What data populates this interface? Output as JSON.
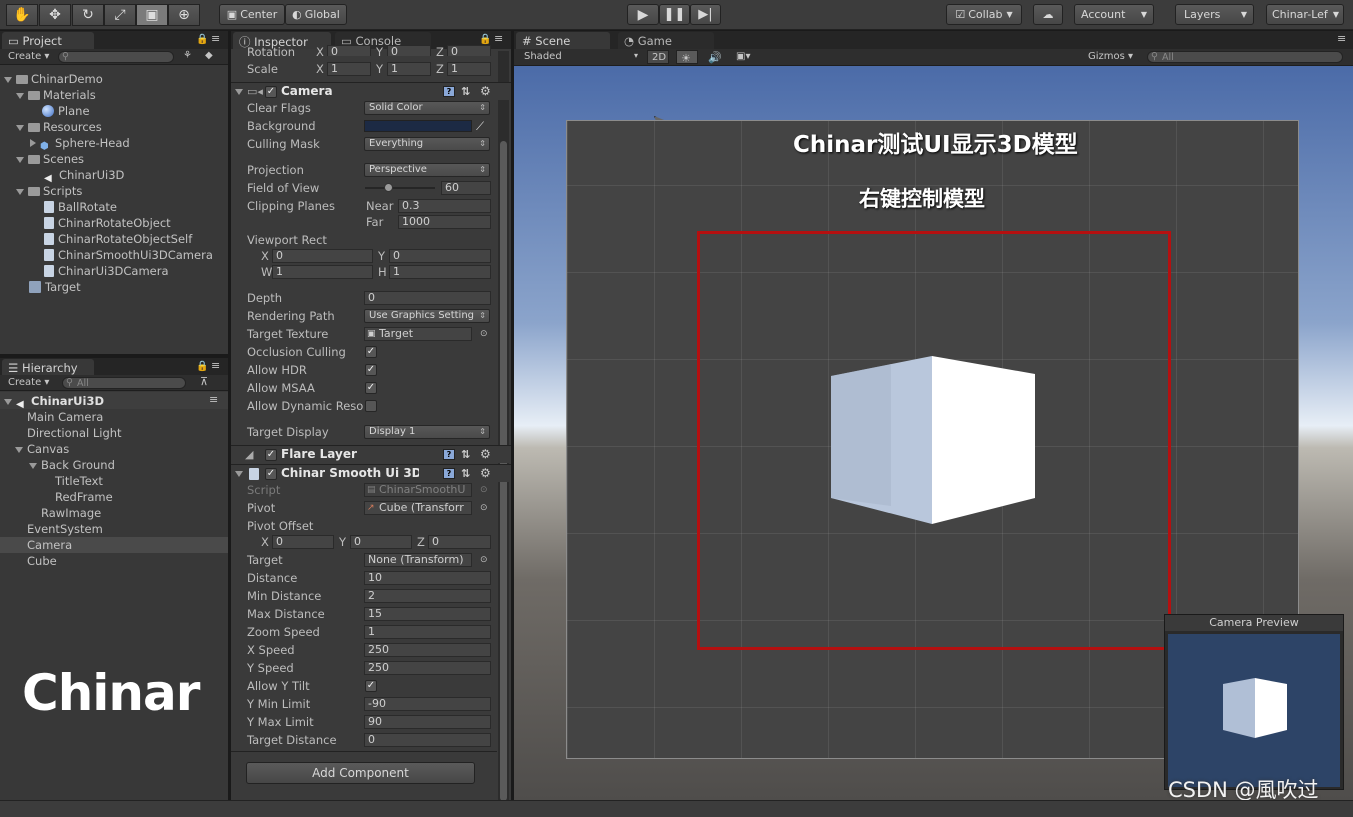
{
  "toolbar": {
    "center_label": "Center",
    "global_label": "Global",
    "collab_label": "Collab",
    "account_label": "Account",
    "layers_label": "Layers",
    "layout_label": "Chinar-Lef"
  },
  "project": {
    "tab_label": "Project",
    "create_label": "Create",
    "items": [
      {
        "label": "ChinarDemo"
      },
      {
        "label": "Materials"
      },
      {
        "label": "Plane"
      },
      {
        "label": "Resources"
      },
      {
        "label": "Sphere-Head"
      },
      {
        "label": "Scenes"
      },
      {
        "label": "ChinarUi3D"
      },
      {
        "label": "Scripts"
      },
      {
        "label": "BallRotate"
      },
      {
        "label": "ChinarRotateObject"
      },
      {
        "label": "ChinarRotateObjectSelf"
      },
      {
        "label": "ChinarSmoothUi3DCamera"
      },
      {
        "label": "ChinarUi3DCamera"
      },
      {
        "label": "Target"
      }
    ]
  },
  "hierarchy": {
    "tab_label": "Hierarchy",
    "create_label": "Create",
    "search_placeholder": "All",
    "scene_name": "ChinarUi3D",
    "items": [
      {
        "label": "Main Camera"
      },
      {
        "label": "Directional Light"
      },
      {
        "label": "Canvas"
      },
      {
        "label": "Back Ground"
      },
      {
        "label": "TitleText"
      },
      {
        "label": "RedFrame"
      },
      {
        "label": "RawImage"
      },
      {
        "label": "EventSystem"
      },
      {
        "label": "Camera"
      },
      {
        "label": "Cube"
      }
    ],
    "watermark": "Chinar"
  },
  "inspector": {
    "tab_label": "Inspector",
    "console_tab_label": "Console",
    "rotation": {
      "label": "Rotation",
      "x": "0",
      "y": "0",
      "z": "0"
    },
    "scale": {
      "label": "Scale",
      "x": "1",
      "y": "1",
      "z": "1"
    },
    "camera": {
      "title": "Camera",
      "clear_flags": {
        "label": "Clear Flags",
        "value": "Solid Color"
      },
      "background_label": "Background",
      "background_color": "#1c2a44",
      "culling_mask": {
        "label": "Culling Mask",
        "value": "Everything"
      },
      "projection": {
        "label": "Projection",
        "value": "Perspective"
      },
      "fov": {
        "label": "Field of View",
        "value": "60",
        "slider_fraction": 0.33
      },
      "clipping": {
        "label": "Clipping Planes",
        "near_label": "Near",
        "near": "0.3",
        "far_label": "Far",
        "far": "1000"
      },
      "viewport": {
        "label": "Viewport Rect",
        "x": "0",
        "y": "0",
        "w": "1",
        "h": "1"
      },
      "depth": {
        "label": "Depth",
        "value": "0"
      },
      "rendering_path": {
        "label": "Rendering Path",
        "value": "Use Graphics Setting"
      },
      "target_texture": {
        "label": "Target Texture",
        "value": "Target"
      },
      "occlusion_culling": {
        "label": "Occlusion Culling"
      },
      "allow_hdr": {
        "label": "Allow HDR"
      },
      "allow_msaa": {
        "label": "Allow MSAA"
      },
      "allow_dynamic": {
        "label": "Allow Dynamic Reso"
      },
      "target_display": {
        "label": "Target Display",
        "value": "Display 1"
      }
    },
    "flare_layer": {
      "title": "Flare Layer"
    },
    "smooth": {
      "title": "Chinar Smooth Ui 3D (",
      "script": {
        "label": "Script",
        "value": "ChinarSmoothU"
      },
      "pivot": {
        "label": "Pivot",
        "value": "Cube (Transforr"
      },
      "pivot_offset": {
        "label": "Pivot Offset",
        "x": "0",
        "y": "0",
        "z": "0"
      },
      "target": {
        "label": "Target",
        "value": "None (Transform)"
      },
      "distance": {
        "label": "Distance",
        "value": "10"
      },
      "min_distance": {
        "label": "Min Distance",
        "value": "2"
      },
      "max_distance": {
        "label": "Max Distance",
        "value": "15"
      },
      "zoom_speed": {
        "label": "Zoom Speed",
        "value": "1"
      },
      "x_speed": {
        "label": "X Speed",
        "value": "250"
      },
      "y_speed": {
        "label": "Y Speed",
        "value": "250"
      },
      "allow_y_tilt": {
        "label": "Allow Y Tilt"
      },
      "y_min": {
        "label": "Y Min Limit",
        "value": "-90"
      },
      "y_max": {
        "label": "Y Max Limit",
        "value": "90"
      },
      "target_distance": {
        "label": "Target Distance",
        "value": "0"
      }
    },
    "add_component_label": "Add Component"
  },
  "scene_view": {
    "tab_label": "Scene",
    "game_tab_label": "Game",
    "shading_label": "Shaded",
    "mode_2d_label": "2D",
    "gizmos_label": "Gizmos",
    "search_placeholder": "All",
    "title_text": "Chinar测试UI显示3D模型",
    "subtitle_text": "右键控制模型",
    "camera_preview_label": "Camera Preview",
    "watermark": "CSDN @風吹过",
    "frame_color": "#b41010"
  }
}
